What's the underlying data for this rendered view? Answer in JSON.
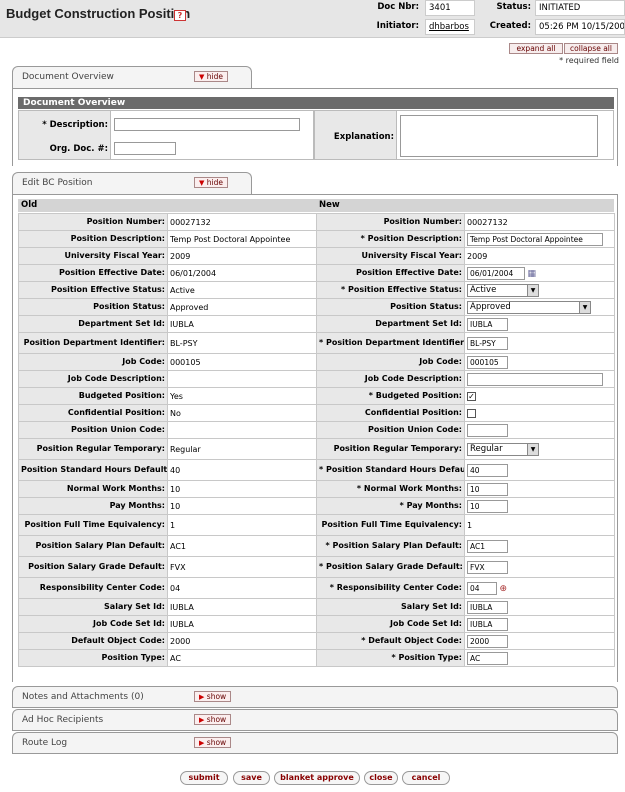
{
  "header": {
    "title": "Budget Construction Position",
    "help_glyph": "?",
    "doc_nbr_label": "Doc Nbr:",
    "doc_nbr": "3401",
    "status_label": "Status:",
    "status": "INITIATED",
    "initiator_label": "Initiator:",
    "initiator": "dhbarbos",
    "created_label": "Created:",
    "created": "05:26 PM 10/15/200"
  },
  "toolbar": {
    "expand_all": "expand all",
    "collapse_all": "collapse all",
    "required_note": "* required field"
  },
  "doc_overview_tab": {
    "label": "Document Overview",
    "hide": "hide",
    "section_title": "Document Overview",
    "description_label": "* Description:",
    "description_value": "",
    "org_doc_label": "Org. Doc. #:",
    "org_doc_value": "",
    "explanation_label": "Explanation:",
    "explanation_value": ""
  },
  "edit_tab": {
    "label": "Edit BC Position",
    "hide": "hide",
    "old_header": "Old",
    "new_header": "New"
  },
  "rows": [
    {
      "label": "Position Number:",
      "old": "00027132",
      "new_label": "Position Number:",
      "new": "00027132",
      "kind": "text",
      "req": false
    },
    {
      "label": "Position Description:",
      "old": "Temp Post Doctoral Appointee",
      "new_label": "Position Description:",
      "new": "Temp Post Doctoral Appointee",
      "kind": "input",
      "req": true
    },
    {
      "label": "University Fiscal Year:",
      "old": "2009",
      "new_label": "University Fiscal Year:",
      "new": "2009",
      "kind": "text",
      "req": false
    },
    {
      "label": "Position Effective Date:",
      "old": "06/01/2004",
      "new_label": "Position Effective Date:",
      "new": "06/01/2004",
      "kind": "date",
      "req": false
    },
    {
      "label": "Position Effective Status:",
      "old": "Active",
      "new_label": "Position Effective Status:",
      "new": "Active",
      "kind": "select",
      "req": true
    },
    {
      "label": "Position Status:",
      "old": "Approved",
      "new_label": "Position Status:",
      "new": "Approved",
      "kind": "selectwide",
      "req": false
    },
    {
      "label": "Department Set Id:",
      "old": "IUBLA",
      "new_label": "Department Set Id:",
      "new": "IUBLA",
      "kind": "input",
      "req": false
    },
    {
      "label": "Position Department Identifier:",
      "old": "BL-PSY",
      "new_label": "Position Department Identifier:",
      "new": "BL-PSY",
      "kind": "input",
      "req": true
    },
    {
      "label": "Job Code:",
      "old": "000105",
      "new_label": "Job Code:",
      "new": "000105",
      "kind": "input",
      "req": false
    },
    {
      "label": "Job Code Description:",
      "old": "",
      "new_label": "Job Code Description:",
      "new": "",
      "kind": "input",
      "req": false
    },
    {
      "label": "Budgeted Position:",
      "old": "Yes",
      "new_label": "Budgeted Position:",
      "new": "✓",
      "kind": "checkbox",
      "req": true
    },
    {
      "label": "Confidential Position:",
      "old": "No",
      "new_label": "Confidential Position:",
      "new": "",
      "kind": "checkbox",
      "req": false
    },
    {
      "label": "Position Union Code:",
      "old": "",
      "new_label": "Position Union Code:",
      "new": "",
      "kind": "input",
      "req": false
    },
    {
      "label": "Position Regular Temporary:",
      "old": "Regular",
      "new_label": "Position Regular Temporary:",
      "new": "Regular",
      "kind": "select",
      "req": false
    },
    {
      "label": "Position Standard Hours Default:",
      "old": "40",
      "new_label": "Position Standard Hours Default:",
      "new": "40",
      "kind": "input",
      "req": true
    },
    {
      "label": "Normal Work Months:",
      "old": "10",
      "new_label": "Normal Work Months:",
      "new": "10",
      "kind": "input",
      "req": true
    },
    {
      "label": "Pay Months:",
      "old": "10",
      "new_label": "Pay Months:",
      "new": "10",
      "kind": "input",
      "req": true
    },
    {
      "label": "Position Full Time Equivalency:",
      "old": "1",
      "new_label": "Position Full Time Equivalency:",
      "new": "1",
      "kind": "text",
      "req": false
    },
    {
      "label": "Position Salary Plan Default:",
      "old": "AC1",
      "new_label": "Position Salary Plan Default:",
      "new": "AC1",
      "kind": "input",
      "req": true
    },
    {
      "label": "Position Salary Grade Default:",
      "old": "FVX",
      "new_label": "Position Salary Grade Default:",
      "new": "FVX",
      "kind": "input",
      "req": true
    },
    {
      "label": "Responsibility Center Code:",
      "old": "04",
      "new_label": "Responsibility Center Code:",
      "new": "04",
      "kind": "lookup",
      "req": true
    },
    {
      "label": "Salary Set Id:",
      "old": "IUBLA",
      "new_label": "Salary Set Id:",
      "new": "IUBLA",
      "kind": "input",
      "req": false
    },
    {
      "label": "Job Code Set Id:",
      "old": "IUBLA",
      "new_label": "Job Code Set Id:",
      "new": "IUBLA",
      "kind": "input",
      "req": false
    },
    {
      "label": "Default Object Code:",
      "old": "2000",
      "new_label": "Default Object Code:",
      "new": "2000",
      "kind": "input",
      "req": true
    },
    {
      "label": "Position Type:",
      "old": "AC",
      "new_label": "Position Type:",
      "new": "AC",
      "kind": "input",
      "req": true
    }
  ],
  "collapsed_tabs": [
    {
      "label": "Notes and Attachments (0)",
      "show": "show"
    },
    {
      "label": "Ad Hoc Recipients",
      "show": "show"
    },
    {
      "label": "Route Log",
      "show": "show"
    }
  ],
  "actions": {
    "submit": "submit",
    "save": "save",
    "blanket_approve": "blanket approve",
    "close": "close",
    "cancel": "cancel"
  },
  "colors": {
    "header_bg": "#e6e6e6",
    "section_bar": "#6b6b6b",
    "label_bg": "#e8e8e8",
    "button_text": "#800000"
  }
}
